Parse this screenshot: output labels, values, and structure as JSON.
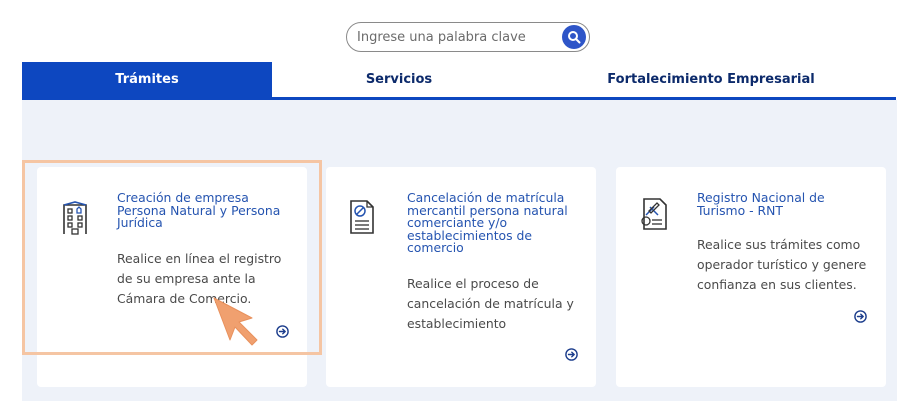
{
  "search": {
    "placeholder": "Ingrese una palabra clave",
    "icon": "search-icon"
  },
  "tabs": [
    {
      "label": "Trámites",
      "active": true
    },
    {
      "label": "Servicios",
      "active": false
    },
    {
      "label": "Fortalecimiento Empresarial",
      "active": false
    }
  ],
  "cards": [
    {
      "icon": "building-icon",
      "title": "Creación de empresa Persona Natural y Persona Jurídica",
      "description": "Realice en línea el registro de su empresa ante la Cámara de Comercio.",
      "action_icon": "arrow-circle-right-icon"
    },
    {
      "icon": "cancel-document-icon",
      "title": "Cancelación de matrícula mercantil persona natural comerciante y/o establecimientos de comercio",
      "description": "Realice el proceso de cancelación de matrícula y establecimiento",
      "action_icon": "arrow-circle-right-icon"
    },
    {
      "icon": "tourism-document-icon",
      "title": "Registro Nacional de Turismo - RNT",
      "description": "Realice sus trámites como operador turístico y genere confianza en sus clientes.",
      "action_icon": "arrow-circle-right-icon"
    }
  ],
  "colors": {
    "primary": "#0d47c0",
    "title_blue": "#2554b0",
    "highlight": "#f5c5a3",
    "cursor": "#f0a06f",
    "panel_bg": "#eef2f9"
  }
}
